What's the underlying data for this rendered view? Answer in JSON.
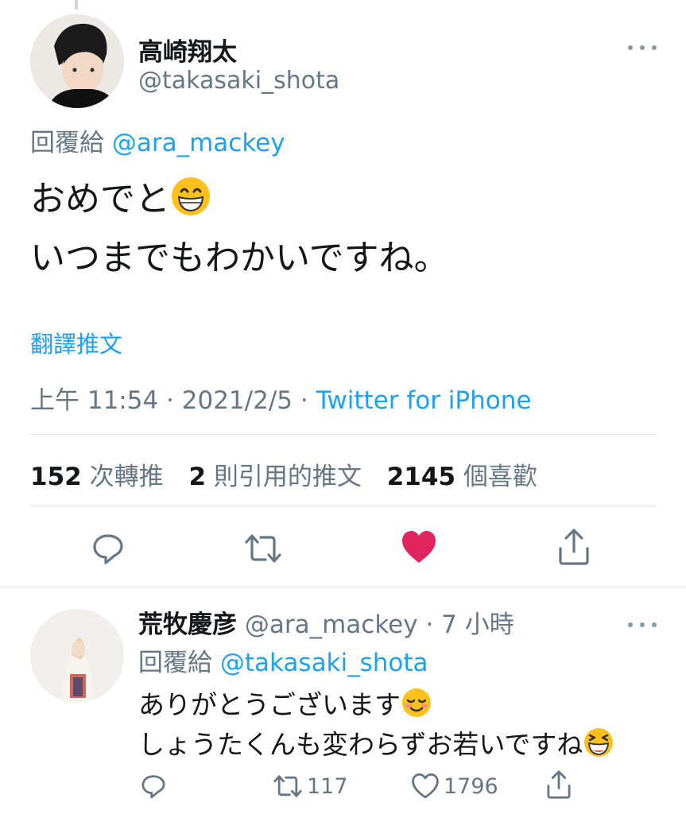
{
  "main_tweet": {
    "author_name": "高崎翔太",
    "author_handle": "@takasaki_shota",
    "reply_to_prefix": "回覆給 ",
    "reply_to_handle": "@ara_mackey",
    "text_line1": "おめでと",
    "text_line2": "いつまでもわかいですね。",
    "emoji_line1": "grinning-face-emoji",
    "translate_label": "翻譯推文",
    "time": "上午 11:54",
    "separator": " · ",
    "date": "2021/2/5",
    "source": "Twitter for iPhone",
    "retweets_count": "152",
    "retweets_label": "次轉推",
    "quotes_count": "2",
    "quotes_label": "則引用的推文",
    "likes_count": "2145",
    "likes_label": "個喜歡",
    "actions": {
      "reply_icon": "reply-icon",
      "retweet_icon": "retweet-icon",
      "like_icon": "heart-filled-icon",
      "share_icon": "share-icon"
    },
    "like_color": "#e0245e"
  },
  "reply_tweet": {
    "author_name": "荒牧慶彦",
    "author_handle": "@ara_mackey",
    "time_sep": " · ",
    "time": "7 小時",
    "reply_to_prefix": "回覆給 ",
    "reply_to_handle": "@takasaki_shota",
    "text_line1": "ありがとうございます",
    "text_line2": "しょうたくんも変わらずお若いですね",
    "emoji_line1": "smiling-face-emoji",
    "emoji_line2": "grinning-squinting-face-emoji",
    "retweet_count": "117",
    "like_count": "1796"
  },
  "colors": {
    "link": "#1da1f2",
    "secondary_text": "#657786",
    "icon_gray": "#657786"
  }
}
